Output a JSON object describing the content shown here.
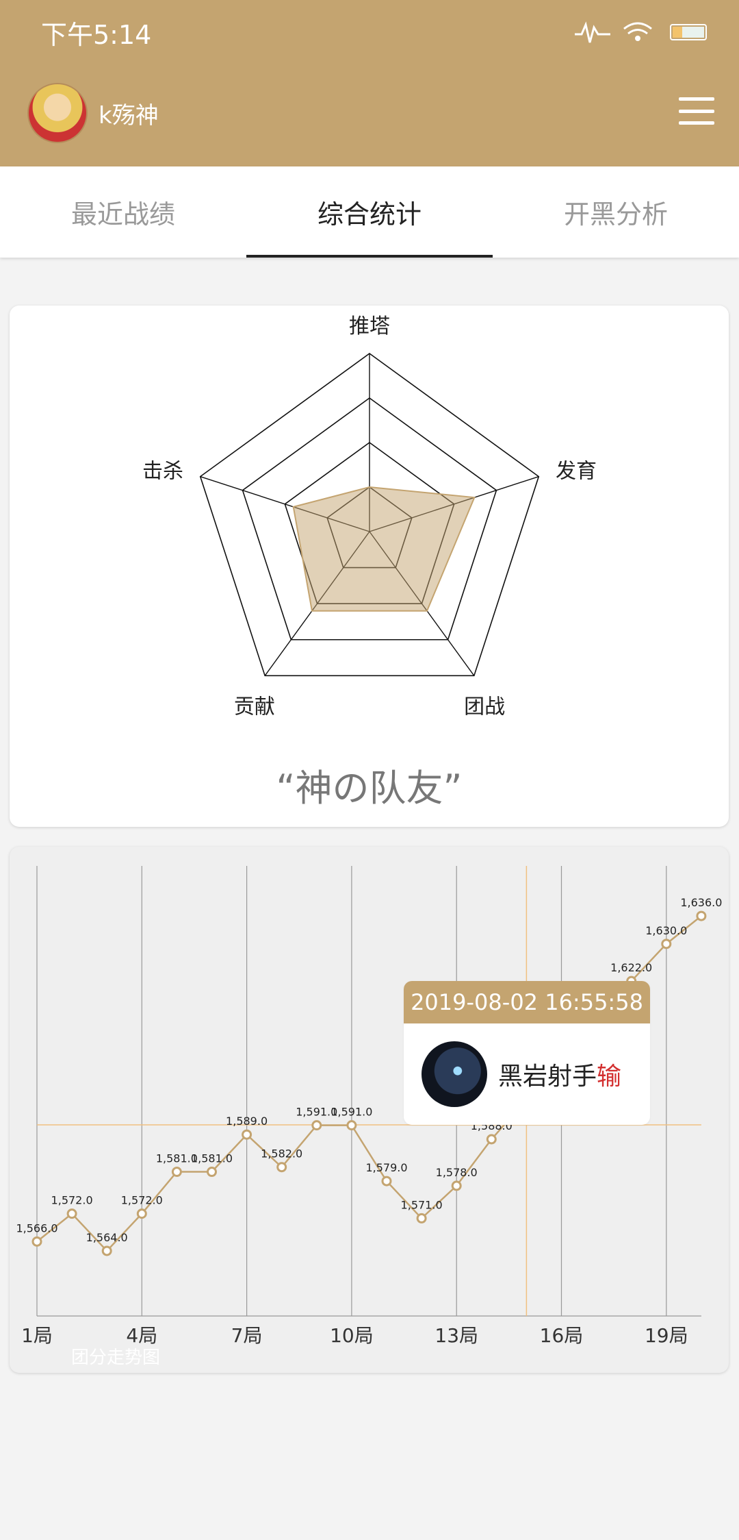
{
  "status_bar": {
    "time": "下午5:14"
  },
  "profile": {
    "username": "k殇神"
  },
  "tabs": [
    {
      "label": "最近战绩",
      "active": false
    },
    {
      "label": "综合统计",
      "active": true
    },
    {
      "label": "开黑分析",
      "active": false
    }
  ],
  "radar": {
    "axes": [
      "推塔",
      "发育",
      "团战",
      "贡献",
      "击杀"
    ],
    "values": [
      0.25,
      0.62,
      0.55,
      0.55,
      0.45
    ],
    "max": 1,
    "fill_color": "#c4a470",
    "title": "“神の队友”"
  },
  "chart_data": {
    "type": "line",
    "x": [
      1,
      2,
      3,
      4,
      5,
      6,
      7,
      8,
      9,
      10,
      11,
      12,
      13,
      14,
      15,
      16,
      17,
      18,
      19,
      20
    ],
    "values": [
      1566.0,
      1572.0,
      1564.0,
      1572.0,
      1581.0,
      1581.0,
      1589.0,
      1582.0,
      1591.0,
      1591.0,
      1579.0,
      1571.0,
      1578.0,
      1588.0,
      null,
      null,
      null,
      1622.0,
      1630.0,
      1636.0
    ],
    "value_labels": [
      "1,566.0",
      "1,572.0",
      "1,564.0",
      "1,572.0",
      "1,581.0",
      "1,581.0",
      "1,589.0",
      "1,582.0",
      "1,591.0",
      "1,591.0",
      "1,579.0",
      "1,571.0",
      "1,578.0",
      "1,588.0",
      "",
      "",
      "",
      "1,622.0",
      "1,630.0",
      "1,636.0"
    ],
    "x_ticks": [
      "1局",
      "4局",
      "7局",
      "10局",
      "13局",
      "16局",
      "19局"
    ],
    "x_tick_positions": [
      1,
      4,
      7,
      10,
      13,
      16,
      19
    ],
    "ylim": [
      1550,
      1645
    ],
    "caption": "团分走势图",
    "line_color": "#c4a470",
    "highlight_x": 15,
    "grid": true
  },
  "tooltip": {
    "datetime": "2019-08-02 16:55:58",
    "hero": "黑岩射手",
    "result": "输"
  }
}
